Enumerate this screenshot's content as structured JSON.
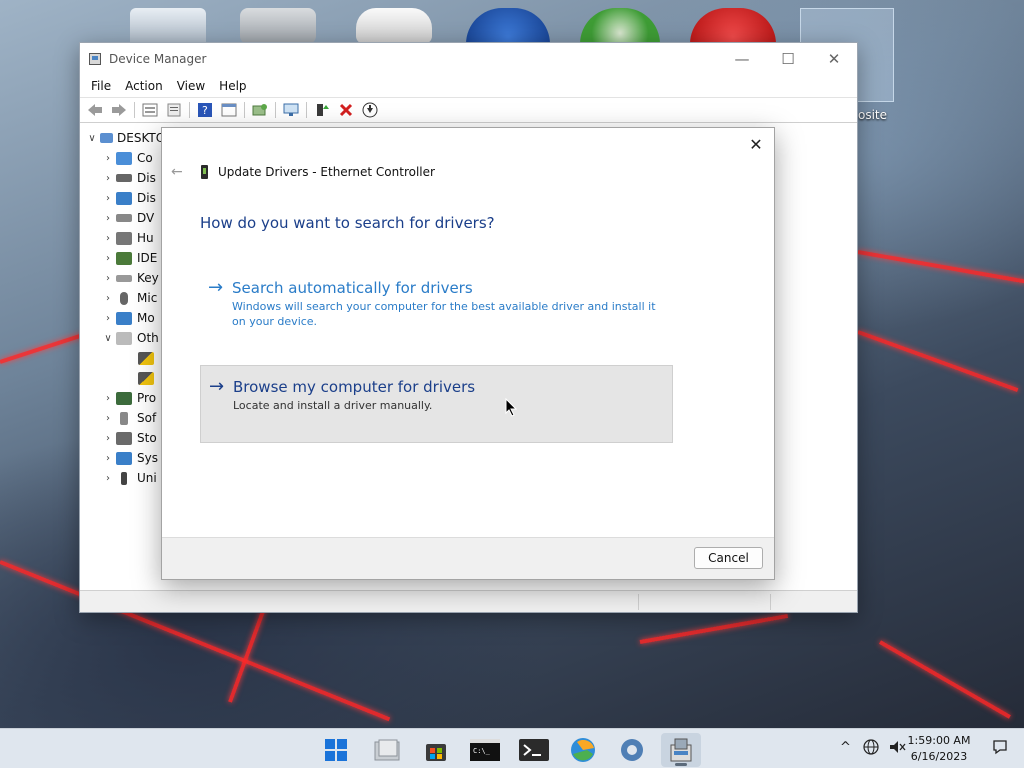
{
  "desktop": {
    "partial_icon_label": "osite"
  },
  "device_manager": {
    "title": "Device Manager",
    "controls": {
      "minimize": "—",
      "maximize": "☐",
      "close": "✕"
    },
    "menu": [
      "File",
      "Action",
      "View",
      "Help"
    ],
    "tree": {
      "root_label": "DESKTO",
      "items": [
        {
          "label": "Co",
          "expanded": false
        },
        {
          "label": "Dis",
          "expanded": false
        },
        {
          "label": "Dis",
          "expanded": false
        },
        {
          "label": "DV",
          "expanded": false
        },
        {
          "label": "Hu",
          "expanded": false
        },
        {
          "label": "IDE",
          "expanded": false
        },
        {
          "label": "Key",
          "expanded": false
        },
        {
          "label": "Mic",
          "expanded": false
        },
        {
          "label": "Mo",
          "expanded": false
        },
        {
          "label": "Oth",
          "expanded": true
        },
        {
          "label": "",
          "expanded": false,
          "child": true
        },
        {
          "label": "",
          "expanded": false,
          "child": true
        },
        {
          "label": "Pro",
          "expanded": false
        },
        {
          "label": "Sof",
          "expanded": false
        },
        {
          "label": "Sto",
          "expanded": false
        },
        {
          "label": "Sys",
          "expanded": false
        },
        {
          "label": "Uni",
          "expanded": false
        }
      ]
    }
  },
  "dialog": {
    "title": "Update Drivers - Ethernet Controller",
    "question": "How do you want to search for drivers?",
    "option_auto": {
      "title": "Search automatically for drivers",
      "description": "Windows will search your computer for the best available driver and install it on your device."
    },
    "option_browse": {
      "title": "Browse my computer for drivers",
      "description": "Locate and install a driver manually."
    },
    "cancel_label": "Cancel",
    "close_glyph": "✕",
    "back_glyph": "←",
    "arrow_glyph": "→"
  },
  "taskbar": {
    "time": "1:59:00 AM",
    "date": "6/16/2023",
    "tray_chevron": "^"
  },
  "colors": {
    "link_blue": "#2a7cc8",
    "heading_navy": "#1b3f8a",
    "error_red": "#d32020"
  }
}
